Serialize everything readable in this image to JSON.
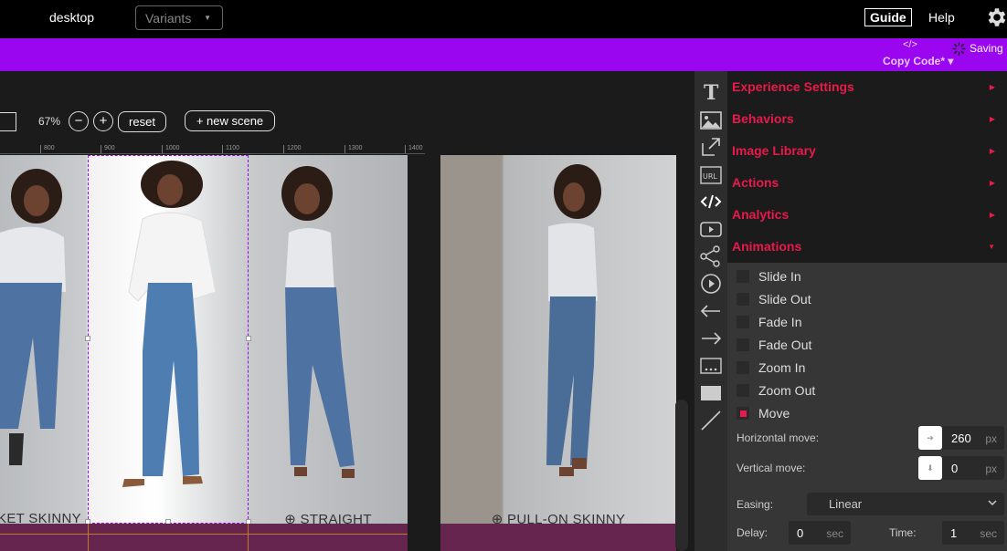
{
  "topbar": {
    "device": "desktop",
    "variants": "Variants",
    "guide": "Guide",
    "help": "Help"
  },
  "purplebar": {
    "code_icon": "</>",
    "copy_code": "Copy Code* ▾",
    "saving": "Saving"
  },
  "canvas": {
    "zoom": "67%",
    "zoom_out": "−",
    "zoom_in": "+",
    "reset": "reset",
    "new_scene": "+ new scene",
    "ruler_ticks": [
      "800",
      "900",
      "1000",
      "1100",
      "1200",
      "1300",
      "1400"
    ],
    "captions": [
      "KET SKINNY",
      "STRAIGHT",
      "PULL-ON SKINNY"
    ],
    "caption_icon": "⊕"
  },
  "toolbar_icons": [
    "text-icon",
    "image-icon",
    "external-link-icon",
    "url-icon",
    "code-icon",
    "video-icon",
    "share-icon",
    "play-icon",
    "arrow-left-icon",
    "arrow-right-icon",
    "ellipsis-box-icon",
    "rectangle-icon",
    "line-icon"
  ],
  "panel": {
    "sections": [
      "Experience Settings",
      "Behaviors",
      "Image Library",
      "Actions",
      "Analytics",
      "Animations"
    ],
    "animations": [
      {
        "label": "Slide In",
        "checked": false
      },
      {
        "label": "Slide Out",
        "checked": false
      },
      {
        "label": "Fade In",
        "checked": false
      },
      {
        "label": "Fade Out",
        "checked": false
      },
      {
        "label": "Zoom In",
        "checked": false
      },
      {
        "label": "Zoom Out",
        "checked": false
      },
      {
        "label": "Move",
        "checked": true
      }
    ],
    "horizontal_move": {
      "label": "Horizontal move:",
      "value": "260",
      "unit": "px"
    },
    "vertical_move": {
      "label": "Vertical move:",
      "value": "0",
      "unit": "px"
    },
    "easing": {
      "label": "Easing:",
      "value": "Linear"
    },
    "delay": {
      "label": "Delay:",
      "value": "0",
      "unit": "sec"
    },
    "time": {
      "label": "Time:",
      "value": "1",
      "unit": "sec"
    }
  },
  "colors": {
    "accent": "#e8194b",
    "purple": "#9a06ef",
    "plum": "#66254e"
  }
}
